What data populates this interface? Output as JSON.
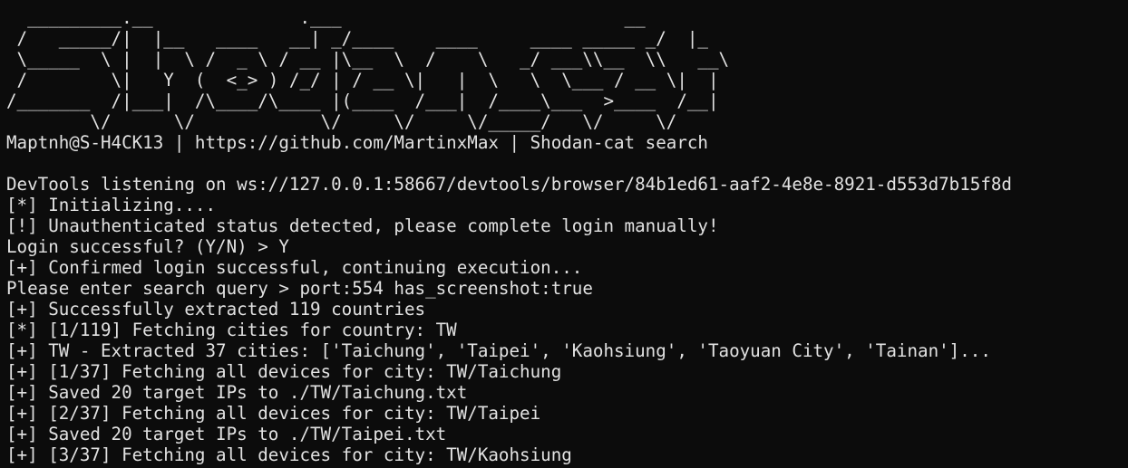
{
  "terminal": {
    "background": "#0c0c0c",
    "foreground": "#e2e2e2",
    "banner": [
      "  _________.__              .___                           __",
      " /   _____/|  |__   ____   __| _/____    ____     ____ _____ _/  |_",
      " \\_____  \\ |  |  \\ /  _ \\ / __ |\\__  \\  /    \\   _/ ___\\\\__  \\\\   __\\",
      " /        \\|   Y  (  <_> ) /_/ | / __ \\|   |  \\   \\  \\___ / __ \\|  |",
      "/_______  /|___|  /\\____/\\____ |(____  /___|  /____\\___  >____  /__|",
      "        \\/      \\/            \\/     \\/     \\/_____/   \\/     \\/"
    ],
    "info_line": "Maptnh@S-H4CK13 | https://github.com/MartinxMax | Shodan-cat search",
    "log": [
      "DevTools listening on ws://127.0.0.1:58667/devtools/browser/84b1ed61-aaf2-4e8e-8921-d553d7b15f8d",
      "[*] Initializing....",
      "[!] Unauthenticated status detected, please complete login manually!",
      "Login successful? (Y/N) > Y",
      "[+] Confirmed login successful, continuing execution...",
      "Please enter search query > port:554 has_screenshot:true",
      "[+] Successfully extracted 119 countries",
      "[*] [1/119] Fetching cities for country: TW",
      "[+] TW - Extracted 37 cities: ['Taichung', 'Taipei', 'Kaohsiung', 'Taoyuan City', 'Tainan']...",
      "[+] [1/37] Fetching all devices for city: TW/Taichung",
      "[+] Saved 20 target IPs to ./TW/Taichung.txt",
      "[+] [2/37] Fetching all devices for city: TW/Taipei",
      "[+] Saved 20 target IPs to ./TW/Taipei.txt",
      "[+] [3/37] Fetching all devices for city: TW/Kaohsiung"
    ]
  }
}
